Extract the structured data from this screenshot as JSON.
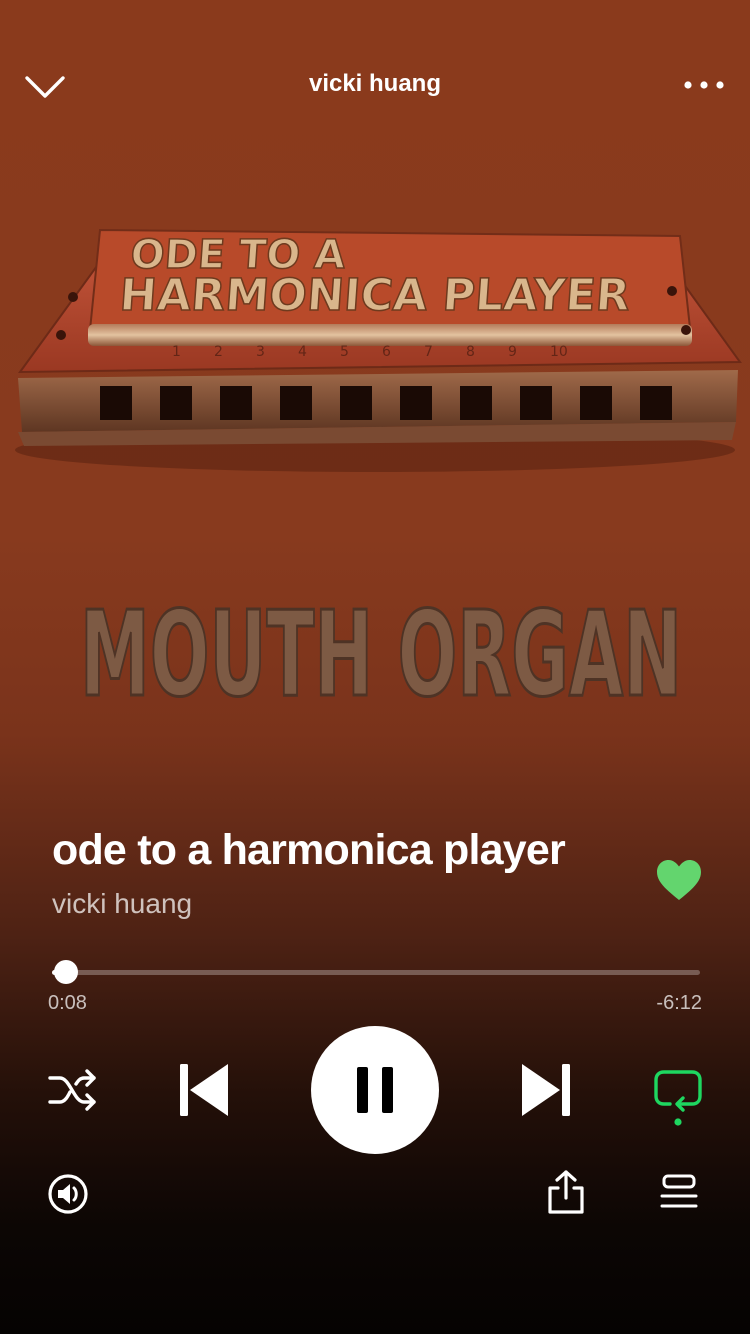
{
  "header": {
    "title": "vicki huang",
    "collapse_icon": "chevron-down-icon",
    "more_icon": "more-horizontal-icon"
  },
  "album_art": {
    "text_top": [
      "ODE TO A",
      "HARMONICA PLAYER"
    ],
    "text_bottom": "MOUTH ORGAN",
    "hole_numbers": [
      "1",
      "2",
      "3",
      "4",
      "5",
      "6",
      "7",
      "8",
      "9",
      "10"
    ],
    "colors": {
      "background": "#8a3a1c",
      "harmonica_red": "#b84a2a",
      "metal": "#c9a477",
      "rust": "#7d5a44"
    }
  },
  "track": {
    "title": "ode to a harmonica player",
    "artist": "vicki huang",
    "liked": true
  },
  "progress": {
    "elapsed": "0:08",
    "remaining": "-6:12",
    "fraction": 0.022
  },
  "controls": {
    "shuffle_icon": "shuffle-icon",
    "previous_icon": "skip-previous-icon",
    "play_pause_icon": "pause-icon",
    "next_icon": "skip-next-icon",
    "repeat_icon": "repeat-icon",
    "repeat_active": true,
    "devices_icon": "devices-icon",
    "share_icon": "share-icon",
    "queue_icon": "queue-icon"
  },
  "colors": {
    "accent_green": "#1ed760",
    "like_green": "#63d56e",
    "text_secondary": "rgba(255,255,255,0.72)"
  }
}
